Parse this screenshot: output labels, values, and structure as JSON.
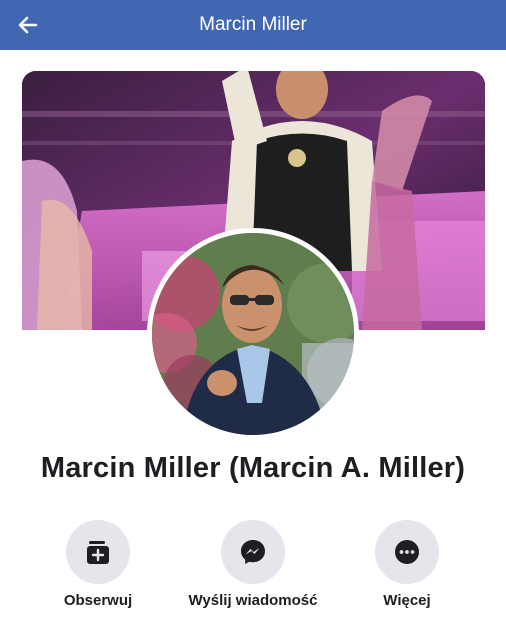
{
  "topbar": {
    "title": "Marcin Miller",
    "back_icon": "arrow-left-icon",
    "background": "#4267b2"
  },
  "profile": {
    "name": "Marcin Miller (Marcin A. Miller)"
  },
  "actions": [
    {
      "label": "Obserwuj",
      "icon": "follow-icon"
    },
    {
      "label": "Wyślij wiadomość",
      "icon": "messenger-icon"
    },
    {
      "label": "Więcej",
      "icon": "more-icon"
    }
  ],
  "colors": {
    "brand": "#4267b2",
    "action_bg": "#e4e6eb",
    "text": "#1c1e21"
  }
}
